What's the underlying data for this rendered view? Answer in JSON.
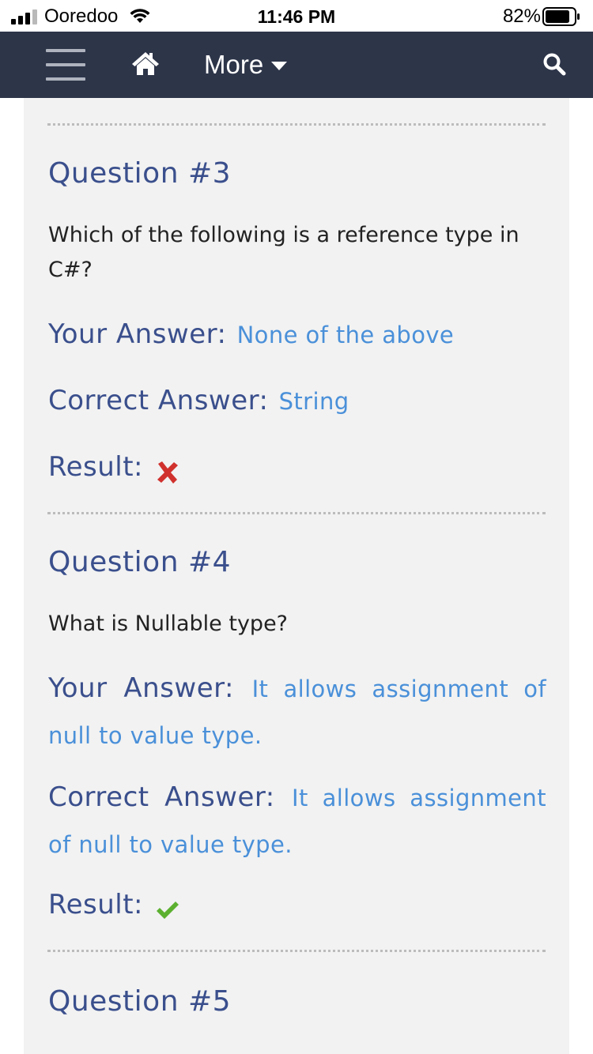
{
  "status_bar": {
    "carrier": "Ooredoo",
    "time": "11:46 PM",
    "battery": "82%"
  },
  "navbar": {
    "menu_icon": "hamburger-menu-icon",
    "home_icon": "home-icon",
    "more_label": "More",
    "search_icon": "search-icon",
    "background": "#2d3549"
  },
  "questions": [
    {
      "title": "Question #3",
      "text": "Which of the following is a reference type in C#?",
      "your_answer_label": "Your Answer:",
      "your_answer": "None of the above",
      "correct_answer_label": "Correct Answer:",
      "correct_answer": "String",
      "result_label": "Result:",
      "result": "incorrect",
      "result_icon": "cross-icon"
    },
    {
      "title": "Question #4",
      "text": "What is Nullable type?",
      "your_answer_label": "Your Answer:",
      "your_answer": "It allows assignment of null to value type.",
      "correct_answer_label": "Correct Answer:",
      "correct_answer": "It allows assignment of null to value type.",
      "result_label": "Result:",
      "result": "correct",
      "result_icon": "checkmark-icon"
    },
    {
      "title": "Question #5"
    }
  ],
  "colors": {
    "heading": "#3a4f8c",
    "answer": "#4a90d9",
    "cross": "#d0312d",
    "check": "#5cb030",
    "panel": "#f2f2f2"
  }
}
